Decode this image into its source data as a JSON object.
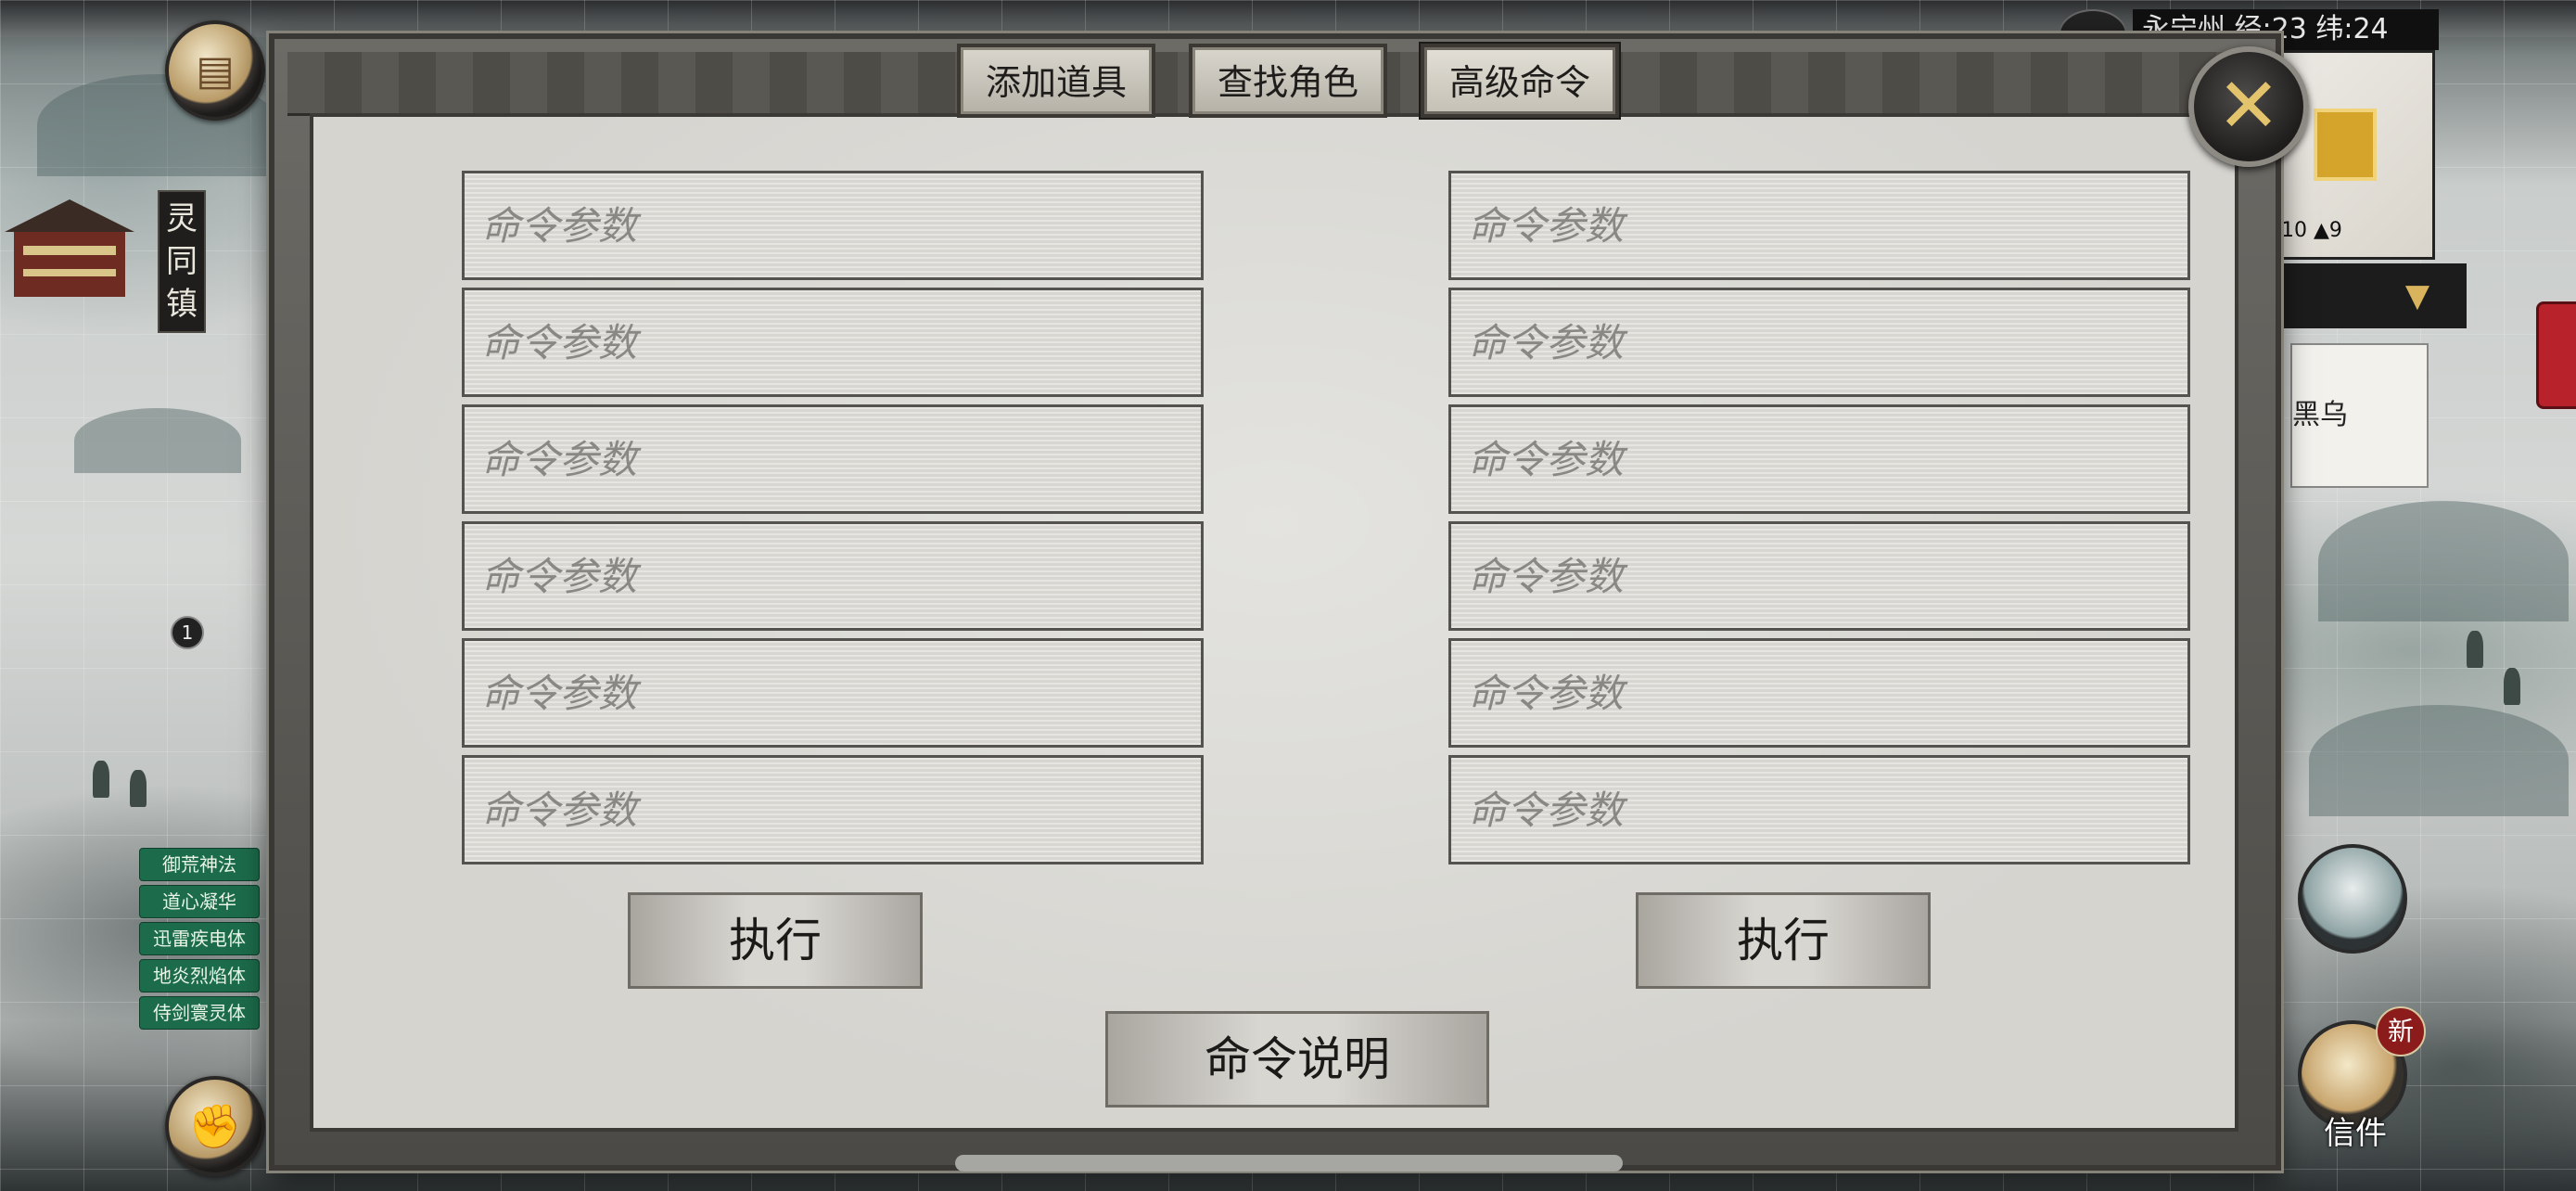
{
  "hud": {
    "town_name": "灵同镇",
    "coords": "永宁州 经:23 纬:24",
    "minimap_stats": "10 ▲9",
    "dropdown_arrow": "▼",
    "npc_card": "黑乌",
    "badge_count": "1",
    "skills": [
      "御荒神法",
      "道心凝华",
      "迅雷疾电体",
      "地炎烈焰体",
      "侍剑寰灵体"
    ],
    "mail_label": "信件",
    "new_badge": "新",
    "icons": {
      "journal": "book-icon",
      "combat": "fist-icon",
      "mail": "letter-icon",
      "pet": "fox-icon"
    }
  },
  "dialog": {
    "tabs": [
      {
        "label": "添加道具",
        "active": false
      },
      {
        "label": "查找角色",
        "active": false
      },
      {
        "label": "高级命令",
        "active": true
      }
    ],
    "close_icon": "close-icon",
    "param_placeholder": "命令参数",
    "left_params": [
      "",
      "",
      "",
      "",
      "",
      ""
    ],
    "right_params": [
      "",
      "",
      "",
      "",
      "",
      ""
    ],
    "execute_label": "执行",
    "help_label": "命令说明"
  },
  "colors": {
    "close_accent": "#e3c46c",
    "skill_green": "#1c6b4a",
    "new_badge_red": "#8c1b1b"
  }
}
